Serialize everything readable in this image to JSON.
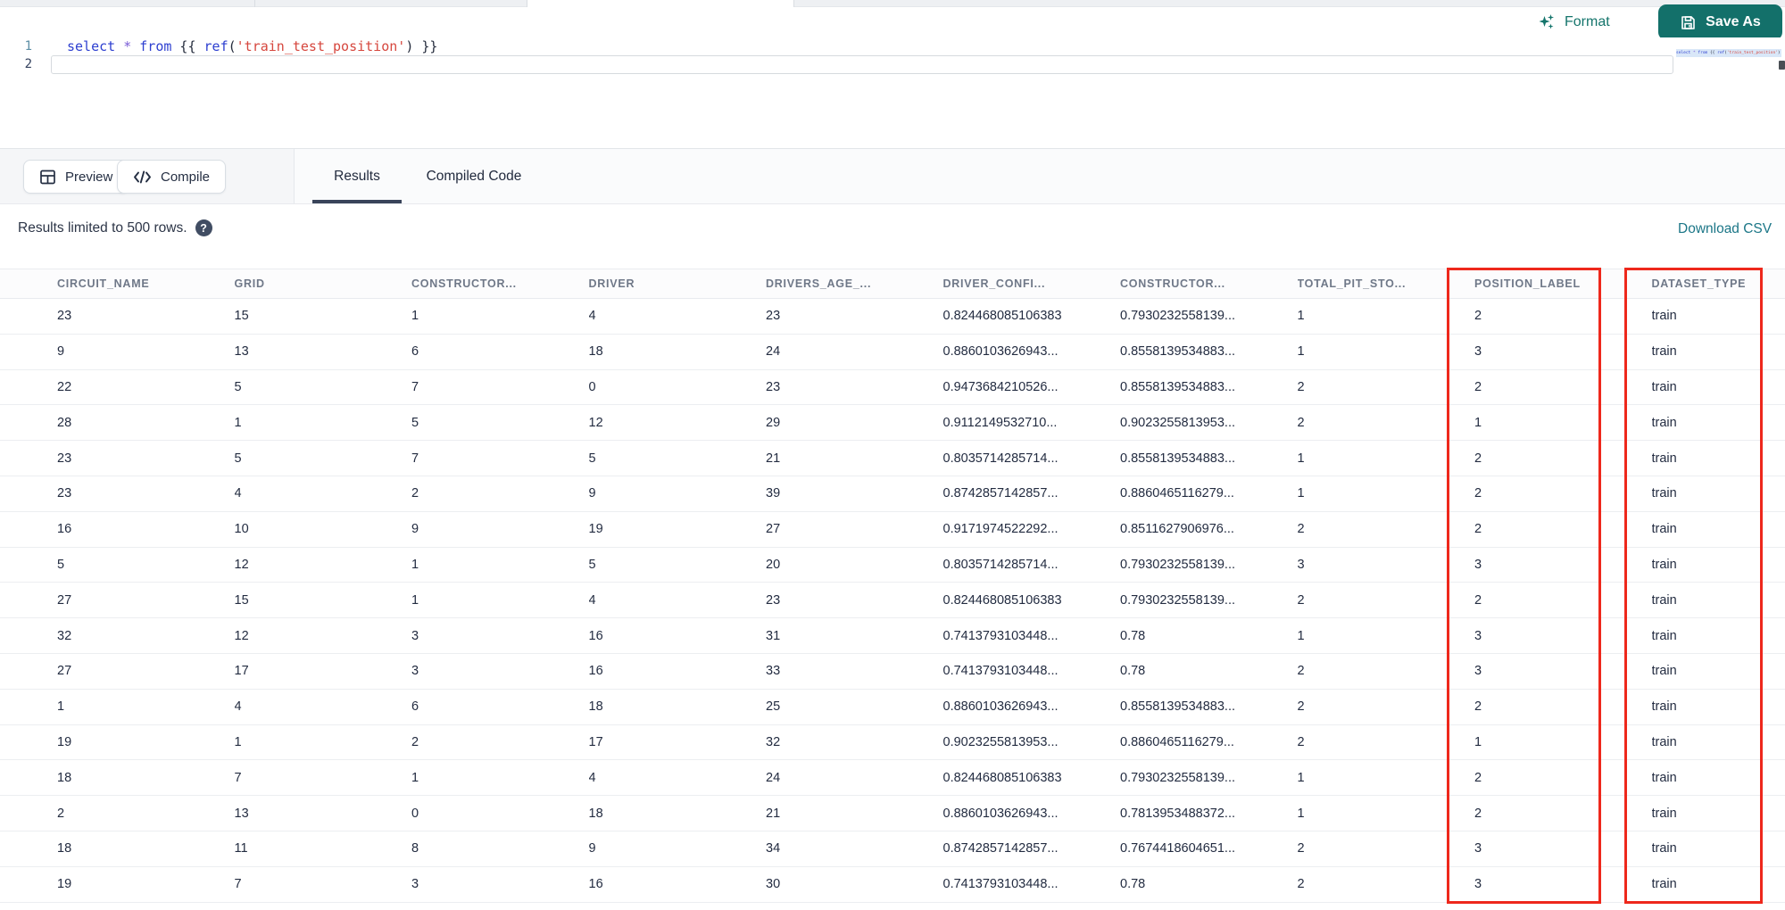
{
  "editor": {
    "format_label": "Format",
    "save_as_label": "Save As",
    "line_numbers": [
      "1",
      "2"
    ],
    "code_tokens": [
      {
        "text": "select",
        "type": "keyword"
      },
      {
        "text": " ",
        "type": "plain"
      },
      {
        "text": "*",
        "type": "star"
      },
      {
        "text": " ",
        "type": "plain"
      },
      {
        "text": "from",
        "type": "keyword"
      },
      {
        "text": " {{ ",
        "type": "brace"
      },
      {
        "text": "ref",
        "type": "func"
      },
      {
        "text": "(",
        "type": "brace"
      },
      {
        "text": "'train_test_position'",
        "type": "string"
      },
      {
        "text": ")",
        "type": "brace"
      },
      {
        "text": " }}",
        "type": "brace"
      }
    ]
  },
  "toolbar": {
    "preview_label": "Preview",
    "compile_label": "Compile",
    "tabs": [
      {
        "label": "Results",
        "active": true
      },
      {
        "label": "Compiled Code",
        "active": false
      }
    ]
  },
  "results": {
    "limit_note": "Results limited to 500 rows.",
    "help_icon_glyph": "?",
    "download_label": "Download CSV"
  },
  "table": {
    "columns": [
      "CIRCUIT_NAME",
      "GRID",
      "CONSTRUCTOR...",
      "DRIVER",
      "DRIVERS_AGE_...",
      "DRIVER_CONFI...",
      "CONSTRUCTOR...",
      "TOTAL_PIT_STO...",
      "POSITION_LABEL",
      "DATASET_TYPE"
    ],
    "rows": [
      [
        "23",
        "15",
        "1",
        "4",
        "23",
        "0.824468085106383",
        "0.7930232558139...",
        "1",
        "2",
        "train"
      ],
      [
        "9",
        "13",
        "6",
        "18",
        "24",
        "0.8860103626943...",
        "0.8558139534883...",
        "1",
        "3",
        "train"
      ],
      [
        "22",
        "5",
        "7",
        "0",
        "23",
        "0.9473684210526...",
        "0.8558139534883...",
        "2",
        "2",
        "train"
      ],
      [
        "28",
        "1",
        "5",
        "12",
        "29",
        "0.9112149532710...",
        "0.9023255813953...",
        "2",
        "1",
        "train"
      ],
      [
        "23",
        "5",
        "7",
        "5",
        "21",
        "0.8035714285714...",
        "0.8558139534883...",
        "1",
        "2",
        "train"
      ],
      [
        "23",
        "4",
        "2",
        "9",
        "39",
        "0.8742857142857...",
        "0.8860465116279...",
        "1",
        "2",
        "train"
      ],
      [
        "16",
        "10",
        "9",
        "19",
        "27",
        "0.9171974522292...",
        "0.8511627906976...",
        "2",
        "2",
        "train"
      ],
      [
        "5",
        "12",
        "1",
        "5",
        "20",
        "0.8035714285714...",
        "0.7930232558139...",
        "3",
        "3",
        "train"
      ],
      [
        "27",
        "15",
        "1",
        "4",
        "23",
        "0.824468085106383",
        "0.7930232558139...",
        "2",
        "2",
        "train"
      ],
      [
        "32",
        "12",
        "3",
        "16",
        "31",
        "0.7413793103448...",
        "0.78",
        "1",
        "3",
        "train"
      ],
      [
        "27",
        "17",
        "3",
        "16",
        "33",
        "0.7413793103448...",
        "0.78",
        "2",
        "3",
        "train"
      ],
      [
        "1",
        "4",
        "6",
        "18",
        "25",
        "0.8860103626943...",
        "0.8558139534883...",
        "2",
        "2",
        "train"
      ],
      [
        "19",
        "1",
        "2",
        "17",
        "32",
        "0.9023255813953...",
        "0.8860465116279...",
        "2",
        "1",
        "train"
      ],
      [
        "18",
        "7",
        "1",
        "4",
        "24",
        "0.824468085106383",
        "0.7930232558139...",
        "1",
        "2",
        "train"
      ],
      [
        "2",
        "13",
        "0",
        "18",
        "21",
        "0.8860103626943...",
        "0.7813953488372...",
        "1",
        "2",
        "train"
      ],
      [
        "18",
        "11",
        "8",
        "9",
        "34",
        "0.8742857142857...",
        "0.7674418604651...",
        "2",
        "3",
        "train"
      ],
      [
        "19",
        "7",
        "3",
        "16",
        "30",
        "0.7413793103448...",
        "0.78",
        "2",
        "3",
        "train"
      ]
    ]
  },
  "annotations": {
    "highlight_color": "#ee281c",
    "highlighted_columns": [
      "POSITION_LABEL",
      "DATASET_TYPE"
    ]
  },
  "colors": {
    "accent_teal": "#13706a",
    "link_teal": "#1b7687",
    "tab_underline": "#39445a",
    "header_text": "#6f7888",
    "cell_text": "#232c41",
    "code_keyword": "#2d3fd0",
    "code_string": "#d6473e"
  }
}
